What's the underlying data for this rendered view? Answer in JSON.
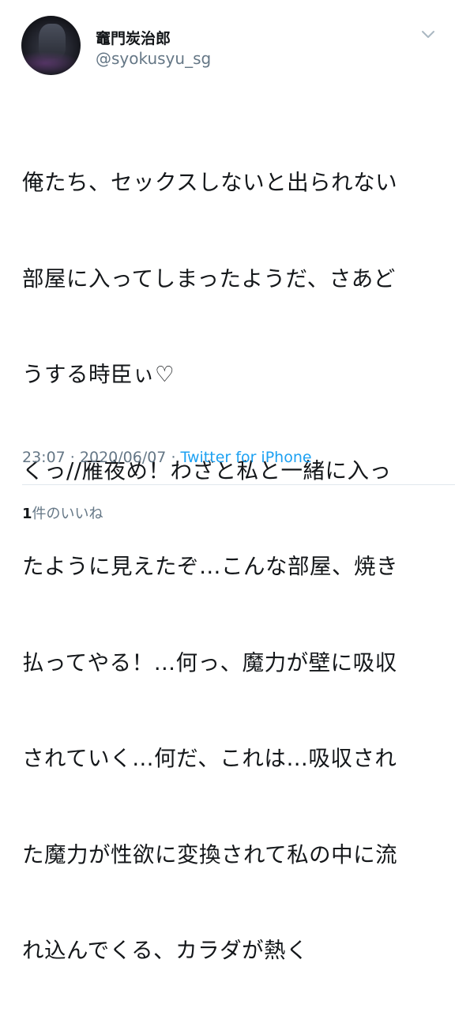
{
  "user": {
    "display_name": "竈門炭治郎",
    "handle": "@syokusyu_sg"
  },
  "icons": {
    "menu": "chevron-down-icon",
    "avatar": "avatar-image"
  },
  "tweet": {
    "lines": [
      "俺たち、セックスしないと出られない",
      "部屋に入ってしまったようだ、さあど",
      "うする時臣ぃ♡",
      "くっ//雁夜め！わざと私と一緒に入っ",
      "たように見えたぞ…こんな部屋、焼き",
      "払ってやる！…何っ、魔力が壁に吸収",
      "されていく…何だ、これは…吸収され",
      "た魔力が性欲に変換されて私の中に流",
      "れ込んでくる、カラダが熱く"
    ]
  },
  "meta": {
    "time": "23:07",
    "separator1": " · ",
    "date": "2020/06/07",
    "separator2": " · ",
    "source": "Twitter for iPhone"
  },
  "likes": {
    "count": "1",
    "label": "件のいいね"
  },
  "colors": {
    "text": "#14171a",
    "secondary": "#657786",
    "link": "#1da1f2",
    "divider": "#e1e8ed"
  }
}
